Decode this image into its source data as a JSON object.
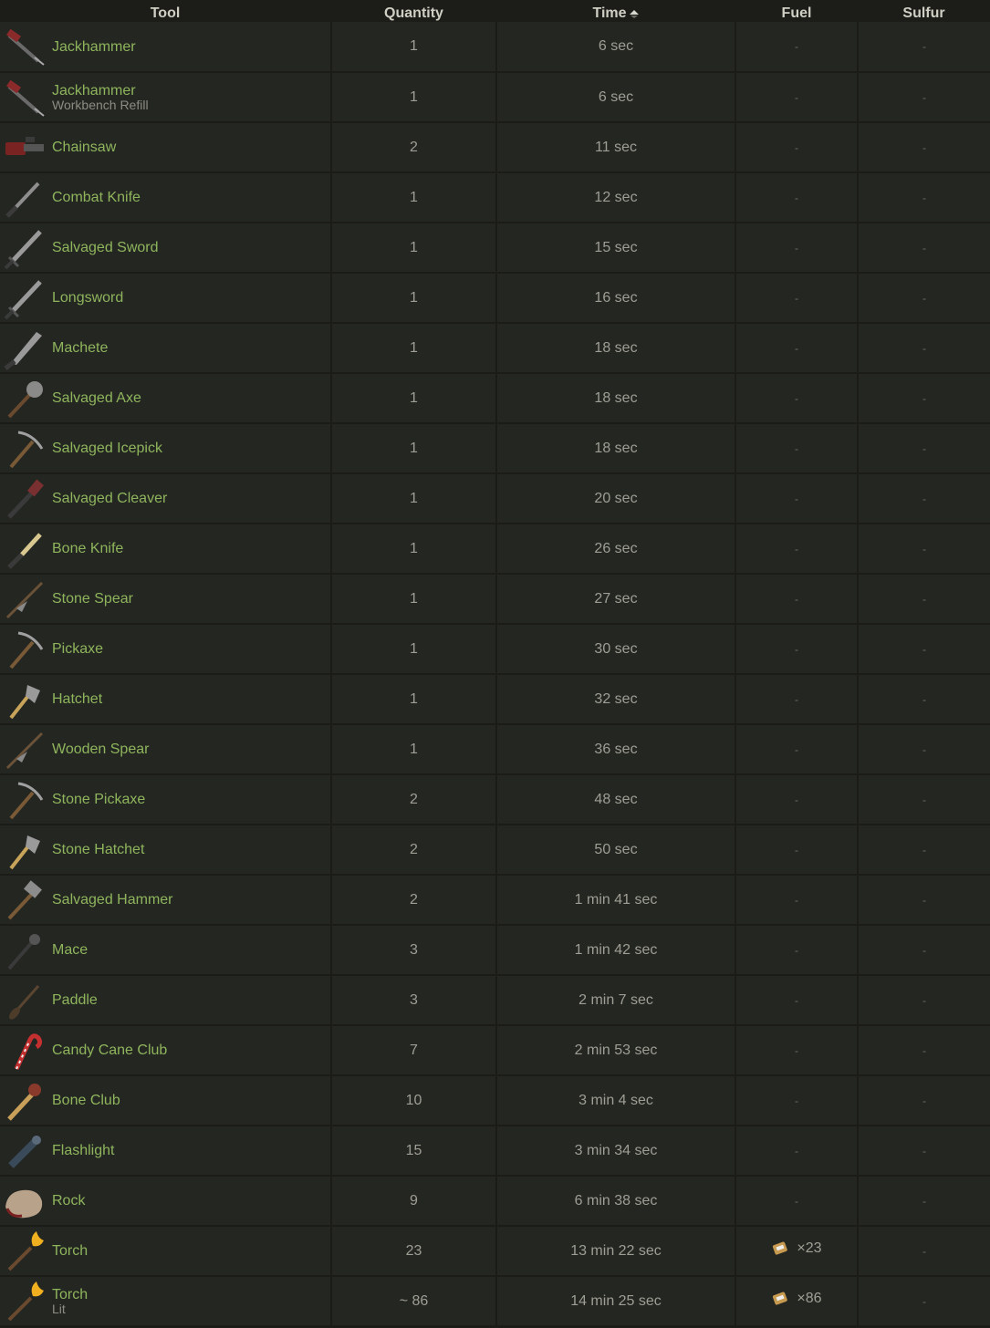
{
  "headers": {
    "tool": "Tool",
    "quantity": "Quantity",
    "time": "Time",
    "fuel": "Fuel",
    "sulfur": "Sulfur"
  },
  "rows": [
    {
      "name": "Jackhammer",
      "sub": "",
      "qty": "1",
      "time": "6 sec",
      "fuel": "-",
      "fuel_qty": "",
      "sulfur": "-",
      "icon": "jackhammer-icon"
    },
    {
      "name": "Jackhammer",
      "sub": "Workbench Refill",
      "qty": "1",
      "time": "6 sec",
      "fuel": "-",
      "fuel_qty": "",
      "sulfur": "-",
      "icon": "jackhammer-icon"
    },
    {
      "name": "Chainsaw",
      "sub": "",
      "qty": "2",
      "time": "11 sec",
      "fuel": "-",
      "fuel_qty": "",
      "sulfur": "-",
      "icon": "chainsaw-icon"
    },
    {
      "name": "Combat Knife",
      "sub": "",
      "qty": "1",
      "time": "12 sec",
      "fuel": "-",
      "fuel_qty": "",
      "sulfur": "-",
      "icon": "knife-icon"
    },
    {
      "name": "Salvaged Sword",
      "sub": "",
      "qty": "1",
      "time": "15 sec",
      "fuel": "-",
      "fuel_qty": "",
      "sulfur": "-",
      "icon": "sword-icon"
    },
    {
      "name": "Longsword",
      "sub": "",
      "qty": "1",
      "time": "16 sec",
      "fuel": "-",
      "fuel_qty": "",
      "sulfur": "-",
      "icon": "sword-icon"
    },
    {
      "name": "Machete",
      "sub": "",
      "qty": "1",
      "time": "18 sec",
      "fuel": "-",
      "fuel_qty": "",
      "sulfur": "-",
      "icon": "machete-icon"
    },
    {
      "name": "Salvaged Axe",
      "sub": "",
      "qty": "1",
      "time": "18 sec",
      "fuel": "-",
      "fuel_qty": "",
      "sulfur": "-",
      "icon": "axe-icon"
    },
    {
      "name": "Salvaged Icepick",
      "sub": "",
      "qty": "1",
      "time": "18 sec",
      "fuel": "-",
      "fuel_qty": "",
      "sulfur": "-",
      "icon": "pickaxe-icon"
    },
    {
      "name": "Salvaged Cleaver",
      "sub": "",
      "qty": "1",
      "time": "20 sec",
      "fuel": "-",
      "fuel_qty": "",
      "sulfur": "-",
      "icon": "cleaver-icon"
    },
    {
      "name": "Bone Knife",
      "sub": "",
      "qty": "1",
      "time": "26 sec",
      "fuel": "-",
      "fuel_qty": "",
      "sulfur": "-",
      "icon": "bone-knife-icon"
    },
    {
      "name": "Stone Spear",
      "sub": "",
      "qty": "1",
      "time": "27 sec",
      "fuel": "-",
      "fuel_qty": "",
      "sulfur": "-",
      "icon": "spear-icon"
    },
    {
      "name": "Pickaxe",
      "sub": "",
      "qty": "1",
      "time": "30 sec",
      "fuel": "-",
      "fuel_qty": "",
      "sulfur": "-",
      "icon": "pickaxe-icon"
    },
    {
      "name": "Hatchet",
      "sub": "",
      "qty": "1",
      "time": "32 sec",
      "fuel": "-",
      "fuel_qty": "",
      "sulfur": "-",
      "icon": "hatchet-icon"
    },
    {
      "name": "Wooden Spear",
      "sub": "",
      "qty": "1",
      "time": "36 sec",
      "fuel": "-",
      "fuel_qty": "",
      "sulfur": "-",
      "icon": "spear-icon"
    },
    {
      "name": "Stone Pickaxe",
      "sub": "",
      "qty": "2",
      "time": "48 sec",
      "fuel": "-",
      "fuel_qty": "",
      "sulfur": "-",
      "icon": "pickaxe-icon"
    },
    {
      "name": "Stone Hatchet",
      "sub": "",
      "qty": "2",
      "time": "50 sec",
      "fuel": "-",
      "fuel_qty": "",
      "sulfur": "-",
      "icon": "hatchet-icon"
    },
    {
      "name": "Salvaged Hammer",
      "sub": "",
      "qty": "2",
      "time": "1 min 41 sec",
      "fuel": "-",
      "fuel_qty": "",
      "sulfur": "-",
      "icon": "hammer-icon"
    },
    {
      "name": "Mace",
      "sub": "",
      "qty": "3",
      "time": "1 min 42 sec",
      "fuel": "-",
      "fuel_qty": "",
      "sulfur": "-",
      "icon": "mace-icon"
    },
    {
      "name": "Paddle",
      "sub": "",
      "qty": "3",
      "time": "2 min 7 sec",
      "fuel": "-",
      "fuel_qty": "",
      "sulfur": "-",
      "icon": "paddle-icon"
    },
    {
      "name": "Candy Cane Club",
      "sub": "",
      "qty": "7",
      "time": "2 min 53 sec",
      "fuel": "-",
      "fuel_qty": "",
      "sulfur": "-",
      "icon": "candy-cane-icon"
    },
    {
      "name": "Bone Club",
      "sub": "",
      "qty": "10",
      "time": "3 min 4 sec",
      "fuel": "-",
      "fuel_qty": "",
      "sulfur": "-",
      "icon": "club-icon"
    },
    {
      "name": "Flashlight",
      "sub": "",
      "qty": "15",
      "time": "3 min 34 sec",
      "fuel": "-",
      "fuel_qty": "",
      "sulfur": "-",
      "icon": "flashlight-icon"
    },
    {
      "name": "Rock",
      "sub": "",
      "qty": "9",
      "time": "6 min 38 sec",
      "fuel": "-",
      "fuel_qty": "",
      "sulfur": "-",
      "icon": "rock-icon"
    },
    {
      "name": "Torch",
      "sub": "",
      "qty": "23",
      "time": "13 min 22 sec",
      "fuel": "",
      "fuel_qty": "×23",
      "sulfur": "-",
      "icon": "torch-icon"
    },
    {
      "name": "Torch",
      "sub": "Lit",
      "qty": "~ 86",
      "time": "14 min 25 sec",
      "fuel": "",
      "fuel_qty": "×86",
      "sulfur": "-",
      "icon": "torch-icon"
    }
  ],
  "colors": {
    "accent": "#8fb55c",
    "row_bg": "#242622",
    "page_bg": "#1c1d19"
  }
}
